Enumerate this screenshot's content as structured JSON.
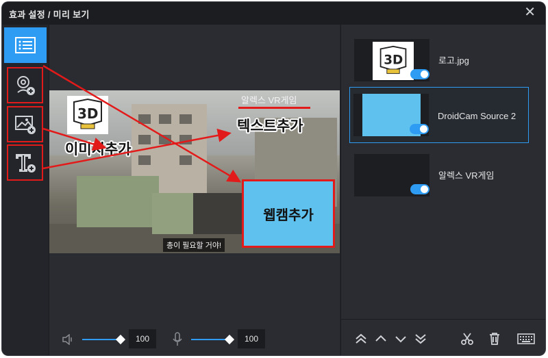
{
  "window": {
    "title": "효과 설정 / 미리 보기",
    "close_glyph": "✕"
  },
  "toolbar": {
    "items": [
      {
        "name": "layers-list-button",
        "icon": "list-icon",
        "active": true
      },
      {
        "name": "add-webcam-button",
        "icon": "webcam-add-icon",
        "highlighted": true
      },
      {
        "name": "add-image-button",
        "icon": "image-add-icon",
        "highlighted": true
      },
      {
        "name": "add-text-button",
        "icon": "text-add-icon",
        "highlighted": true
      }
    ]
  },
  "preview": {
    "text_overlay": "알렉스 VR게임",
    "webcam_label": "웹캠추가",
    "subtitle": "총이 필요할 거야!",
    "annotations": {
      "add_image": "이미지추가",
      "add_text": "텍스트추가"
    }
  },
  "controls": {
    "speaker_volume": {
      "value": "100",
      "level": 0.9
    },
    "mic_volume": {
      "value": "100",
      "level": 0.9
    }
  },
  "layers": [
    {
      "name": "로고.jpg",
      "enabled": true,
      "selected": false,
      "thumb": "logo"
    },
    {
      "name": "DroidCam Source 2",
      "enabled": true,
      "selected": true,
      "thumb": "webcam"
    },
    {
      "name": "알렉스 VR게임",
      "enabled": true,
      "selected": false,
      "thumb": "blank"
    }
  ],
  "layer_actions": [
    "move-to-top-icon",
    "move-up-icon",
    "move-down-icon",
    "move-to-bottom-icon",
    "scissors-icon",
    "trash-icon",
    "keyboard-icon"
  ],
  "colors": {
    "accent": "#2f9cf4",
    "annotation_red": "#e31a1a",
    "webcam_fill": "#5fc1ee"
  }
}
